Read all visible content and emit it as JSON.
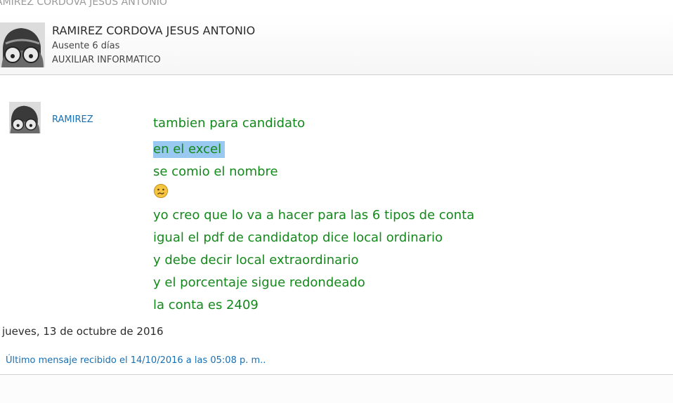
{
  "window": {
    "title": "AMIREZ CORDOVA JESUS ANTONIO"
  },
  "contact": {
    "name": "RAMIREZ CORDOVA JESUS ANTONIO",
    "status": "Ausente 6 días",
    "role": "AUXILIAR INFORMATICO"
  },
  "conversation": {
    "sender": "RAMIREZ",
    "messages": [
      "tambien para candidato",
      "en el excel",
      "se comio el nombre",
      "yo creo que lo va a hacer para las 6 tipos de conta",
      "igual el pdf de candidatop dice local ordinario",
      "y debe decir local extraordinario",
      "y el porcentaje sigue redondeado",
      "la conta es 2409"
    ],
    "emoji": "worried-face-icon",
    "date_separator": "jueves, 13 de octubre de 2016",
    "last_received": "Último mensaje recibido el 14/10/2016 a las 05:08 p. m.."
  },
  "colors": {
    "message_text": "#13891b",
    "link_text": "#1770b5",
    "selection_highlight": "#99c9f1"
  }
}
